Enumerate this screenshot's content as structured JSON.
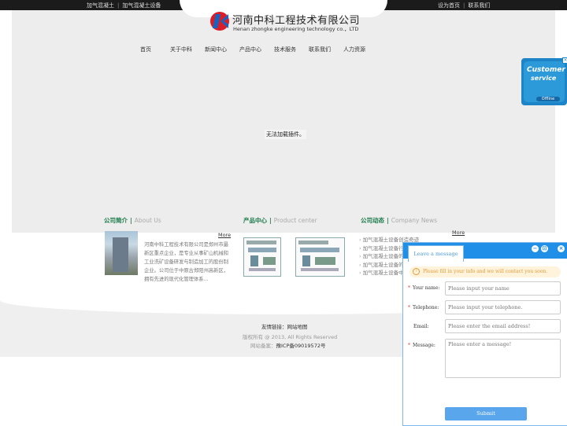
{
  "topbar": {
    "left_links": [
      "加气混凝土",
      "加气混凝土设备"
    ],
    "left_sep": "|",
    "right_links": [
      "设为首页",
      "联系我们"
    ],
    "right_sep": "|"
  },
  "logo": {
    "cn": "河南中科工程技术有限公司",
    "en": "Henan zhongke engineering technology co.，LTD"
  },
  "nav": [
    "首页",
    "关于中科",
    "新闻中心",
    "产品中心",
    "技术服务",
    "联系我们",
    "人力资源"
  ],
  "plugin_msg": "无法加载插件。",
  "customer_service": {
    "line1": "Customer",
    "line2": "service",
    "status": "Offline",
    "close": "×"
  },
  "about": {
    "title": "公司简介",
    "title_en": "About Us",
    "more": "More",
    "text": "河南中科工程技术有限公司是郑州市最新区重点企业，是专业从事矿山机械和工业洗矿设备研发与制造加工的股份制企业。公司位于中原古郑阳州高新区，拥有先进的现代化管理体系..."
  },
  "products": {
    "title": "产品中心",
    "title_en": "Product center"
  },
  "news": {
    "title": "公司动态",
    "title_en": "Company News",
    "more": "More",
    "items": [
      "加气混凝土设备创造奇迹",
      "加气混凝土设备行",
      "加气混凝土设备的",
      "加气混凝土设备的",
      "加气混凝土设备中"
    ]
  },
  "footer": {
    "friend_label": "友情链接：",
    "friend_link": "网站地图",
    "copyright": "版权所有 @ 2013, All Rights Reserved",
    "icp_label": "网站备案：",
    "icp_value": "豫ICP备09019572号"
  },
  "chat": {
    "tab": "Leave a message",
    "buttons": [
      "−",
      "⊡",
      "×"
    ],
    "notice": "Please fill in your info and we will contact you soon.",
    "notice_icon": "!",
    "fields": [
      {
        "label": "Your name:",
        "required": "*",
        "placeholder": "Please input your name"
      },
      {
        "label": "Telephone:",
        "required": "*",
        "placeholder": "Please input your telephone."
      },
      {
        "label": "Email:",
        "required": "",
        "placeholder": "Please enter the email address!"
      }
    ],
    "message_label": "Message:",
    "message_required": "*",
    "message_placeholder": "Please enter a message!",
    "submit": "Submit"
  },
  "colors": {
    "accent_green": "#1a7a4a",
    "chat_blue": "#1f8fe8",
    "logo_red": "#d91e2a",
    "logo_blue": "#1565c0"
  }
}
